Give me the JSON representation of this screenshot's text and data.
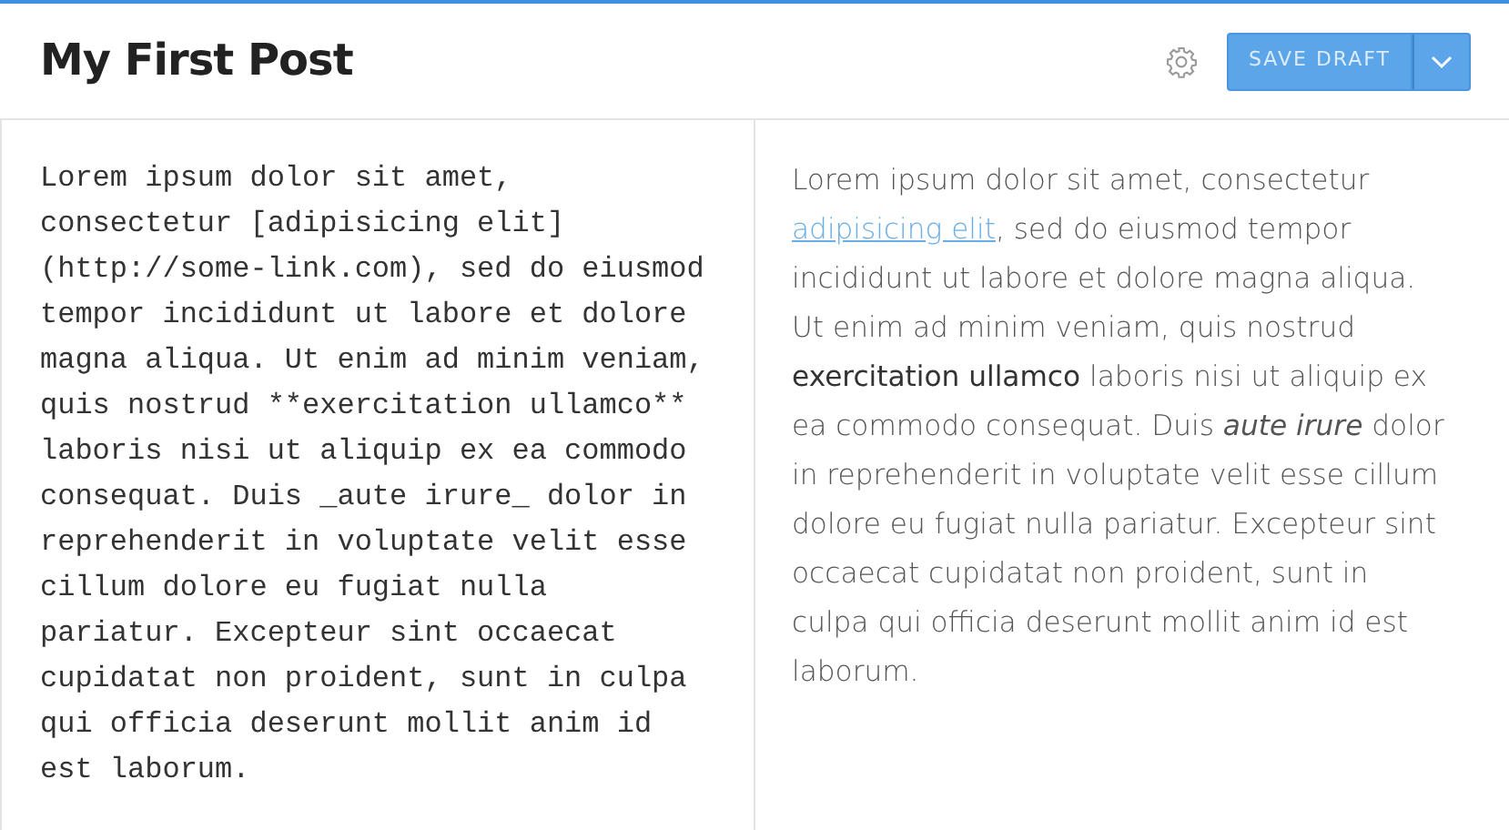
{
  "post": {
    "title": "My First Post"
  },
  "toolbar": {
    "save_button": "SAVE DRAFT"
  },
  "editor": {
    "value": "Lorem ipsum dolor sit amet, consectetur [adipisicing elit](http://some-link.com), sed do eiusmod tempor incididunt ut labore et dolore magna aliqua. Ut enim ad minim veniam, quis nostrud **exercitation ullamco** laboris nisi ut aliquip ex ea commodo consequat. Duis _aute irure_ dolor in reprehenderit in voluptate velit esse cillum dolore eu fugiat nulla pariatur. Excepteur sint occaecat cupidatat non proident, sunt in culpa qui officia deserunt mollit anim id est laborum."
  },
  "preview": {
    "segments": [
      {
        "kind": "text",
        "text": "Lorem ipsum dolor sit amet, consectetur "
      },
      {
        "kind": "link",
        "text": "adipisicing elit"
      },
      {
        "kind": "text",
        "text": ", sed do eiusmod tempor incididunt ut labore et dolore magna aliqua. Ut enim ad minim veniam, quis nostrud **exercitation ullamco** laboris nisi ut aliquip ex ea commodo consequat. Duis *aute irure* dolor in reprehenderit in voluptate velit esse cillum dolore eu fugiat nulla pariatur. Excepteur sint occaecat cupidatat non proident, sunt in culpa qui officia deserunt mollit anim id est laborum."
      }
    ]
  }
}
